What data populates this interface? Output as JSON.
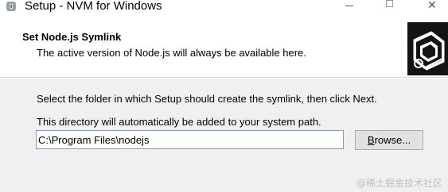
{
  "window": {
    "title": "Setup - NVM for Windows"
  },
  "header": {
    "title": "Set Node.js Symlink",
    "subtitle": "The active version of Node.js will always be available here."
  },
  "body": {
    "instruction": "Select the folder in which Setup should create the symlink, then click Next.",
    "path_note": "This directory will automatically be added to your system path.",
    "path_value": "C:\\Program Files\\nodejs",
    "browse_label_underlined": "B",
    "browse_label_rest": "rowse..."
  },
  "watermark": "@稀土掘金技术社区",
  "colors": {
    "header_bg": "#ffffff",
    "body_bg": "#f0f0f0",
    "input_border": "#7a9cd3",
    "button_bg": "#e1e1e1"
  },
  "icons": {
    "app": "setup-app-icon",
    "minimize": "minimize-icon",
    "maximize": "maximize-icon",
    "close": "close-icon",
    "logo": "nvm-logo-icon"
  }
}
